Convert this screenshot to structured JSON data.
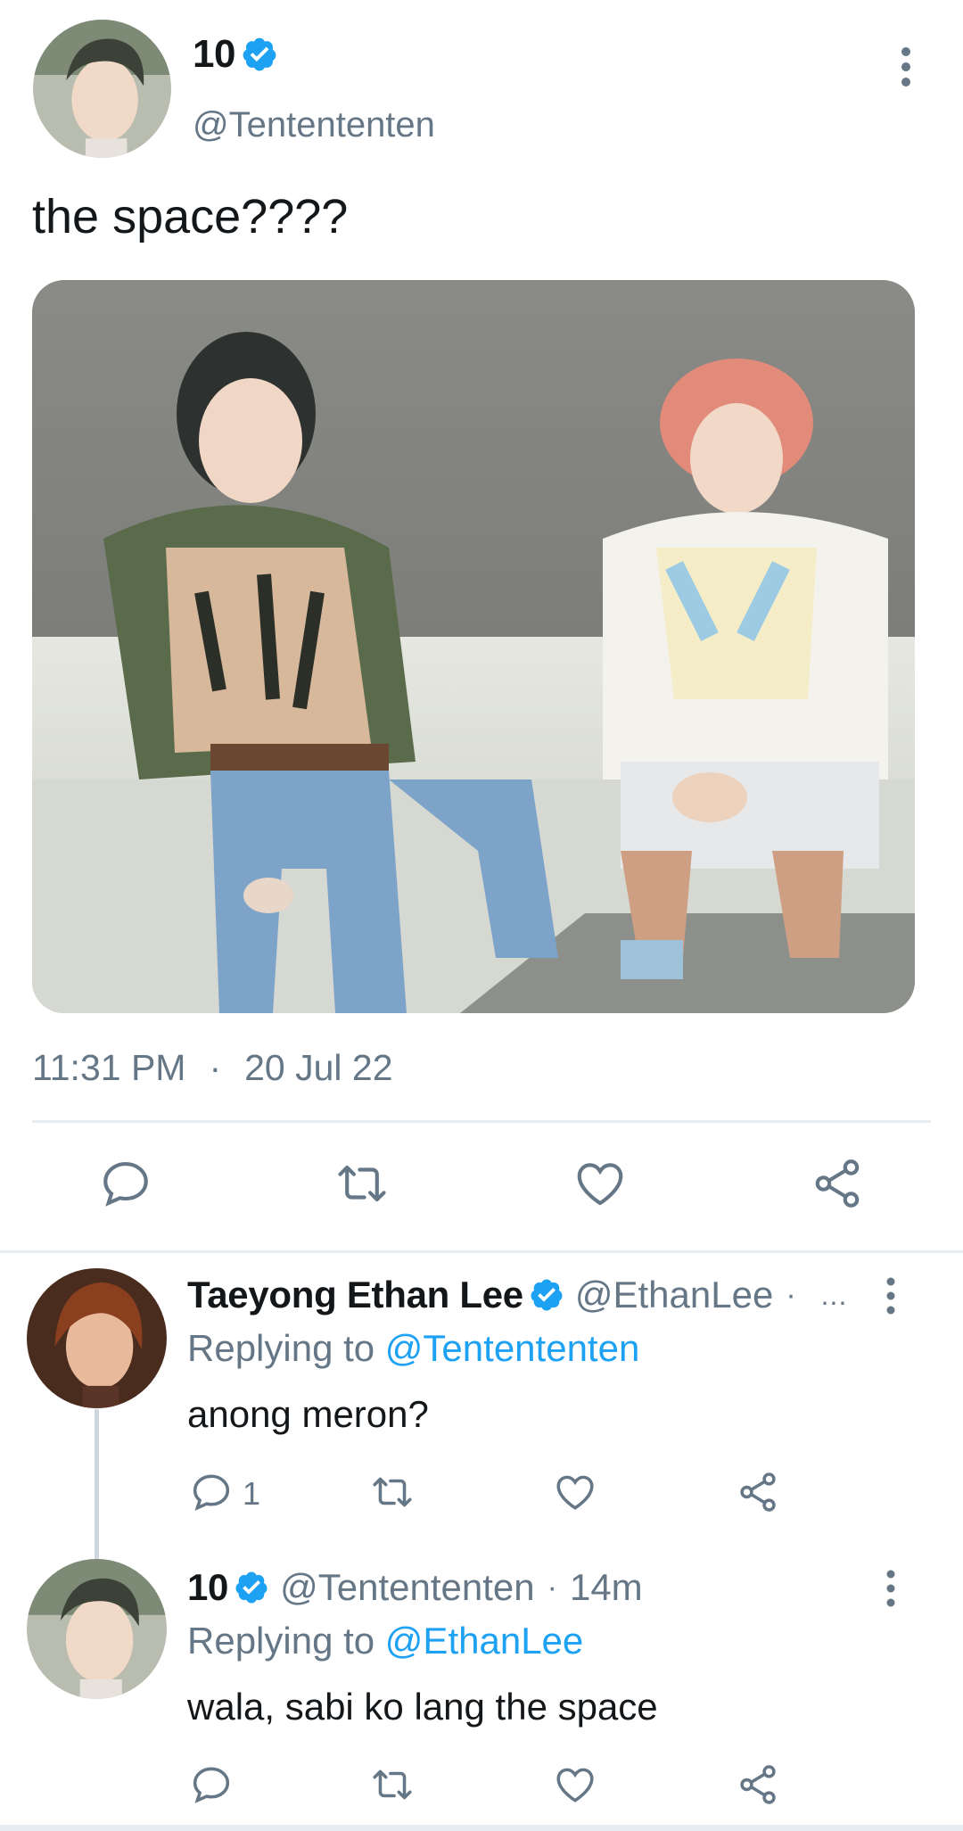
{
  "main_tweet": {
    "author_name": "10",
    "author_handle": "@Tentententen",
    "text": "the space????",
    "time": "11:31 PM",
    "separator": "·",
    "date": "20 Jul 22",
    "avatar_icon": "avatar-photo",
    "media_description_icon": "photo"
  },
  "replies": [
    {
      "author_name": "Taeyong Ethan Lee",
      "author_handle": "@EthanLee",
      "separator": "·",
      "time": "",
      "ellipsis": "...",
      "replying_prefix": "Replying to ",
      "replying_to": "@Tentententen",
      "text": "anong meron?",
      "reply_count": "1"
    },
    {
      "author_name": "10",
      "author_handle": "@Tentententen",
      "separator": "·",
      "time": "14m",
      "replying_prefix": "Replying to ",
      "replying_to": "@EthanLee",
      "text": "wala, sabi ko lang the space",
      "reply_count": ""
    }
  ],
  "colors": {
    "accent": "#1da1f2",
    "secondary_text": "#657786",
    "primary_text": "#14171a",
    "divider": "#e6ecf0"
  },
  "icons": [
    "comment-icon",
    "retweet-icon",
    "like-icon",
    "share-icon",
    "verified-badge-icon",
    "more-options-icon"
  ]
}
